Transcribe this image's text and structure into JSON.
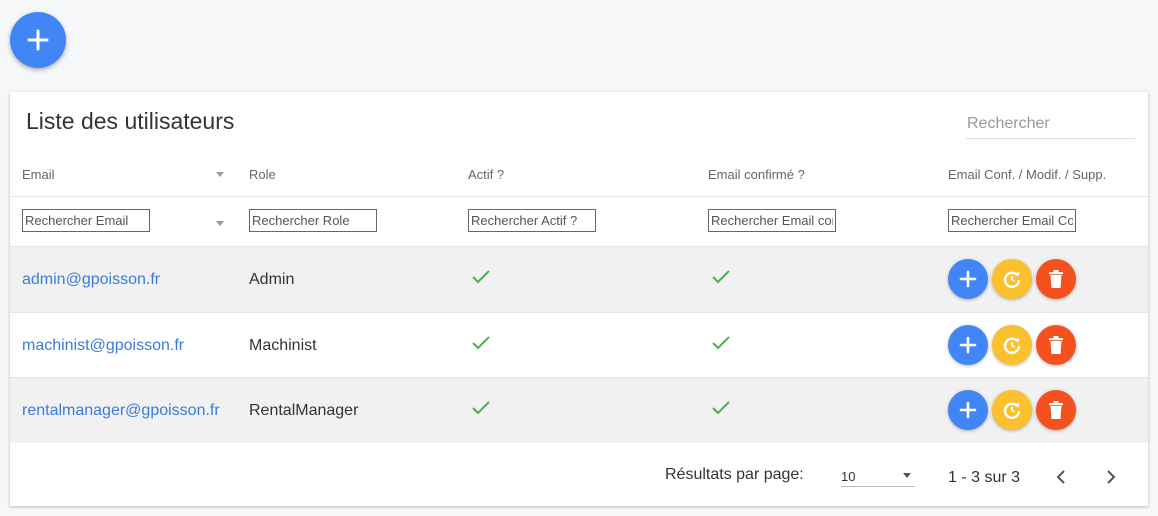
{
  "title": "Liste des utilisateurs",
  "search": {
    "placeholder": "Rechercher"
  },
  "columns": [
    "Email",
    "Role",
    "Actif ?",
    "Email confirmé ?",
    "Email Conf. / Modif. / Supp."
  ],
  "filters": [
    "Rechercher Email",
    "Rechercher Role",
    "Rechercher Actif ?",
    "Rechercher Email con",
    "Rechercher Email Con"
  ],
  "rows": [
    {
      "email": "admin@gpoisson.fr",
      "role": "Admin",
      "actif": true,
      "email_confirmed": true
    },
    {
      "email": "machinist@gpoisson.fr",
      "role": "Machinist",
      "actif": true,
      "email_confirmed": true
    },
    {
      "email": "rentalmanager@gpoisson.fr",
      "role": "RentalManager",
      "actif": true,
      "email_confirmed": true
    }
  ],
  "footer": {
    "rows_per_page_label": "Résultats par page:",
    "rows_per_page_value": "10",
    "range": "1 - 3 sur 3"
  },
  "colors": {
    "primary": "#4285f4",
    "warning": "#fbc02d",
    "danger": "#f4511e",
    "link": "#3a7cd5",
    "check": "#4caf50"
  },
  "icons": {
    "fab": "plus-icon",
    "confirm": "plus-icon",
    "modify": "refresh-icon",
    "delete": "trash-icon",
    "prev": "chevron-left-icon",
    "next": "chevron-right-icon"
  }
}
